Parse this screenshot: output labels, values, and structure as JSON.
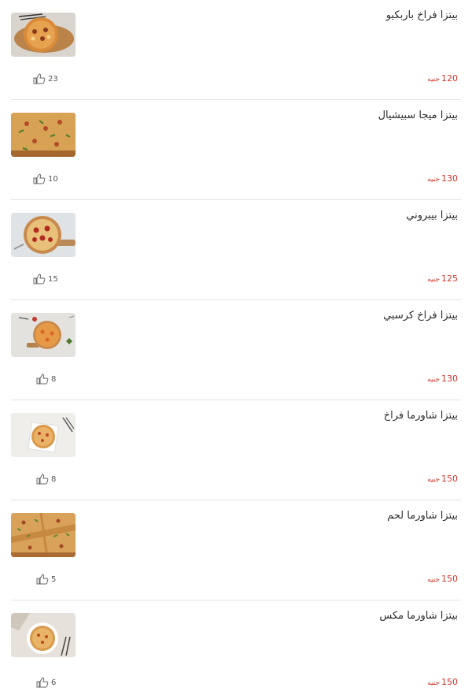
{
  "menu": {
    "items": [
      {
        "title": "بيتزا فراخ باربكيو",
        "price": "120",
        "currency": "جنيه",
        "likes": "23",
        "image": "pizza-bbq-chicken"
      },
      {
        "title": "بيتزا ميجا سبيشيال",
        "price": "130",
        "currency": "جنيه",
        "likes": "10",
        "image": "pizza-mega-special"
      },
      {
        "title": "بيتزا بيبروني",
        "price": "125",
        "currency": "جنيه",
        "likes": "15",
        "image": "pizza-pepperoni"
      },
      {
        "title": "بيتزا فراخ كرسبي",
        "price": "130",
        "currency": "جنيه",
        "likes": "8",
        "image": "pizza-crispy-chicken"
      },
      {
        "title": "بيتزا شاورما فراخ",
        "price": "150",
        "currency": "جنيه",
        "likes": "8",
        "image": "pizza-chicken-shawarma"
      },
      {
        "title": "بيتزا شاورما لحم",
        "price": "150",
        "currency": "جنيه",
        "likes": "5",
        "image": "pizza-meat-shawarma"
      },
      {
        "title": "بيتزا شاورما مكس",
        "price": "150",
        "currency": "جنيه",
        "likes": "6",
        "image": "pizza-mixed-shawarma"
      }
    ]
  },
  "icons": {
    "like": "thumbs-up-icon"
  },
  "colors": {
    "price": "#d0362a",
    "divider": "#e2e2e2",
    "title": "#2b2b2b"
  }
}
